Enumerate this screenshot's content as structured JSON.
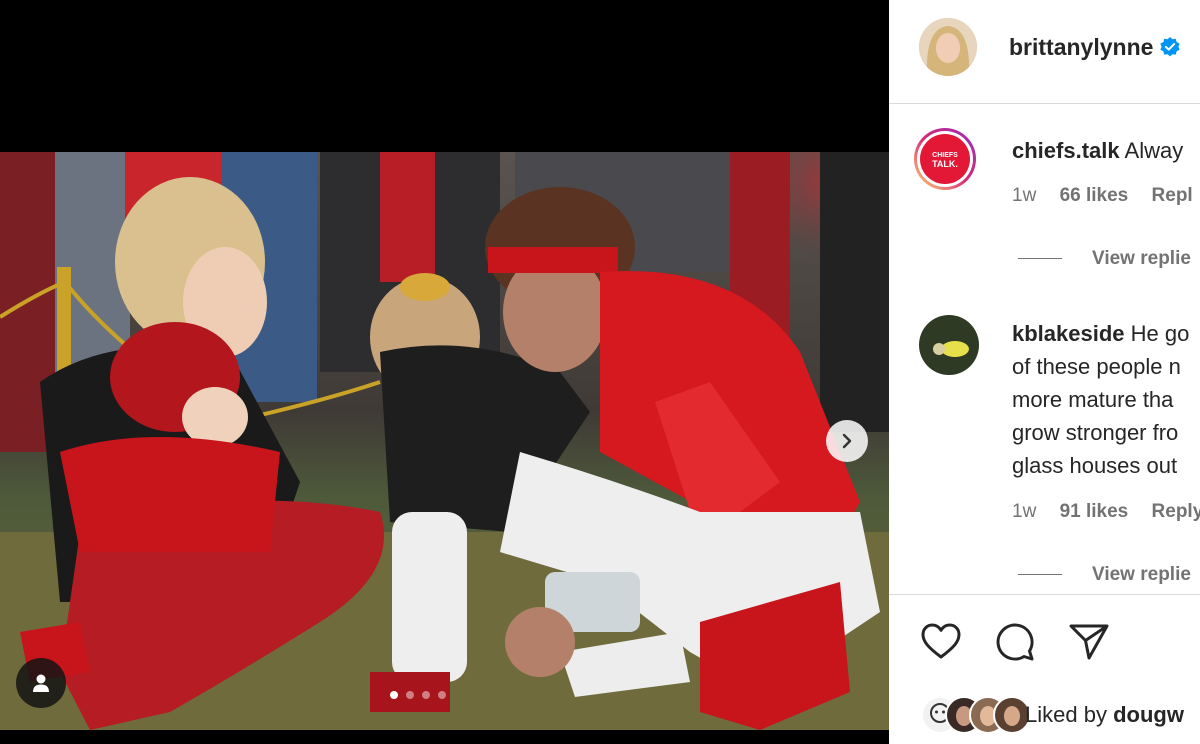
{
  "post": {
    "author": "brittanylynne",
    "verified": true,
    "carousel": {
      "current": 1,
      "total": 4
    },
    "icons": {
      "next": "chevron-right-icon",
      "tag": "person-icon",
      "verified": "verified-badge-icon"
    }
  },
  "comments": [
    {
      "user": "chiefs.talk",
      "text": "Alway",
      "time": "1w",
      "likes": "66 likes",
      "reply": "Repl",
      "view_replies": "View replie",
      "avatar_text": "CHIEFS TALK",
      "avatar_icon": "chiefs-talk-logo-icon"
    },
    {
      "user": "kblakeside",
      "lines": [
        "He go",
        "of these people n",
        "more mature tha",
        "grow stronger fro",
        "glass houses out"
      ],
      "time": "1w",
      "likes": "91 likes",
      "reply": "Reply",
      "view_replies": "View replie",
      "avatar_icon": "user-avatar-icon"
    }
  ],
  "actions": {
    "like": "heart-icon",
    "comment": "comment-bubble-icon",
    "share": "paper-plane-icon"
  },
  "liked_by": {
    "prefix": "Liked by ",
    "user": "dougw"
  },
  "colors": {
    "accent": "#e31837",
    "verified": "#0095f6",
    "muted": "#737373",
    "text": "#262626"
  }
}
